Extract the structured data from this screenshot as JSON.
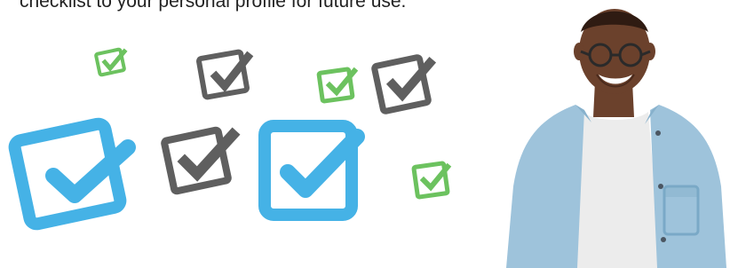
{
  "intro": {
    "text": "checklist to your personal profile for future use."
  },
  "colors": {
    "blue": "#45b2e6",
    "gray": "#5f5f5f",
    "green": "#6cc25f",
    "text": "#222222",
    "shirt": "#9ec3db",
    "tshirt": "#ececec",
    "skin": "#6b412c"
  },
  "icons": [
    "checkbox-icon-green",
    "checkbox-icon-gray",
    "checkbox-icon-blue",
    "person-photo"
  ]
}
